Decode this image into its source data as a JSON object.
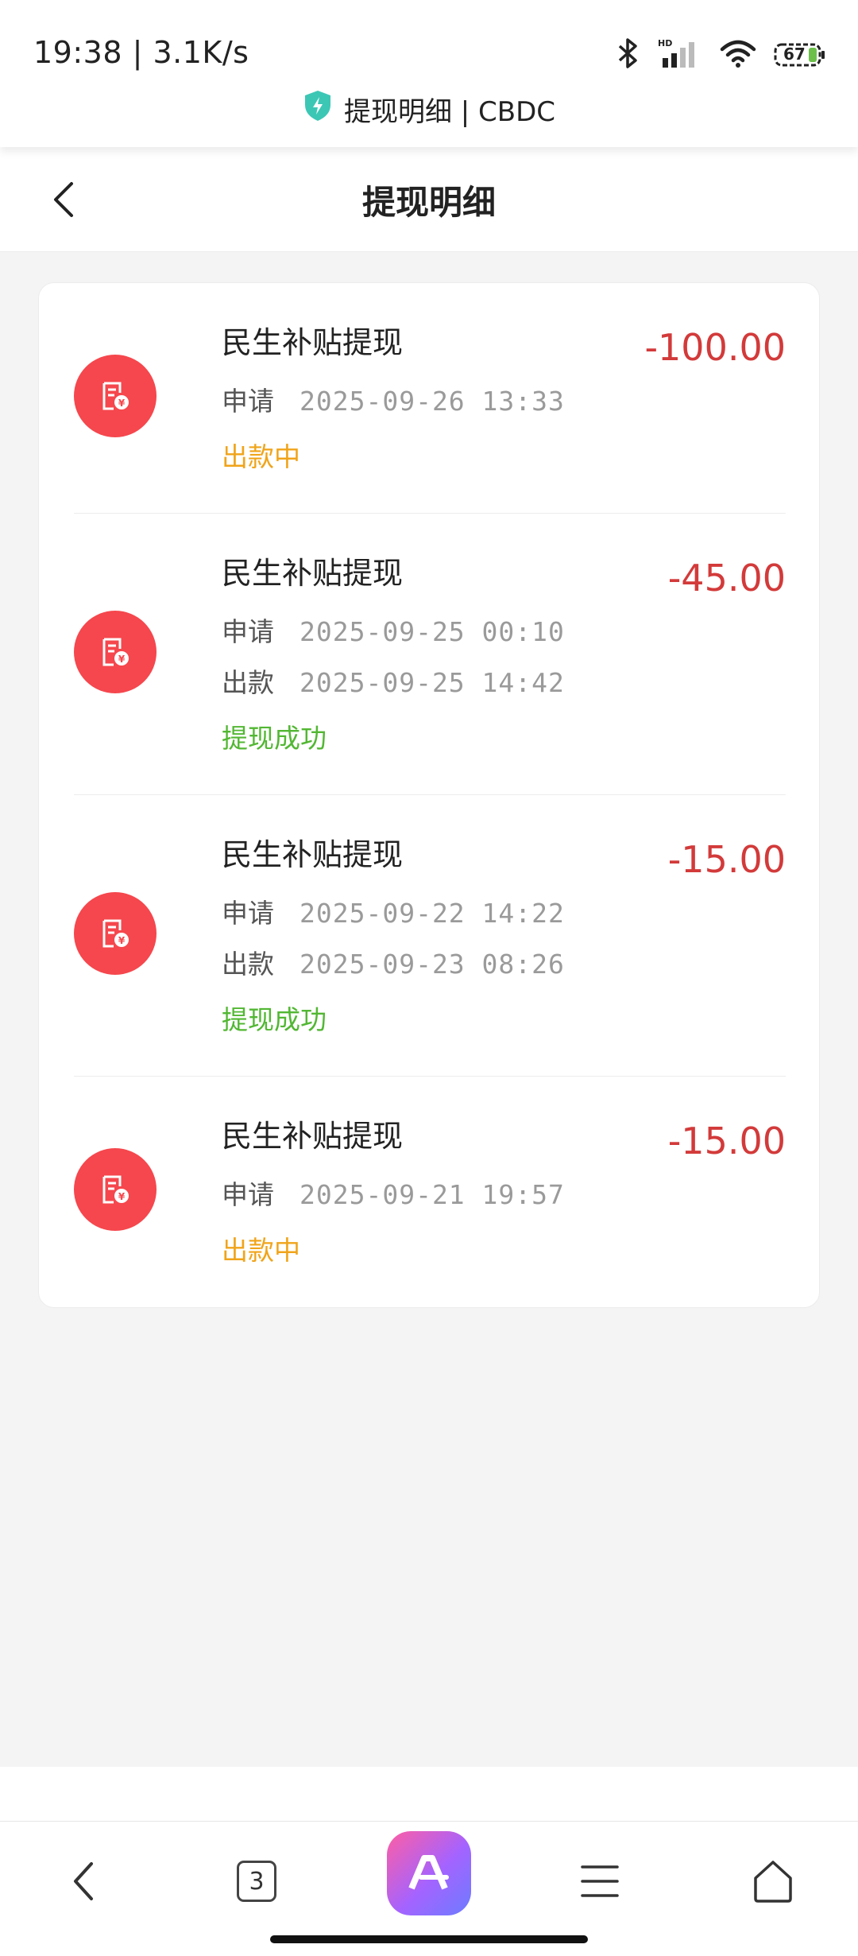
{
  "status_bar": {
    "time_speed": "19:38 | 3.1K/s",
    "site_title": "提现明细 | CBDC",
    "battery": "67"
  },
  "header": {
    "title": "提现明细"
  },
  "records": [
    {
      "title": "民生补贴提现",
      "amount": "-100.00",
      "lines": [
        {
          "label": "申请",
          "value": "2025-09-26  13:33"
        }
      ],
      "status": "出款中",
      "status_type": "pending"
    },
    {
      "title": "民生补贴提现",
      "amount": "-45.00",
      "lines": [
        {
          "label": "申请",
          "value": "2025-09-25  00:10"
        },
        {
          "label": "出款",
          "value": "2025-09-25  14:42"
        }
      ],
      "status": "提现成功",
      "status_type": "success"
    },
    {
      "title": "民生补贴提现",
      "amount": "-15.00",
      "lines": [
        {
          "label": "申请",
          "value": "2025-09-22  14:22"
        },
        {
          "label": "出款",
          "value": "2025-09-23  08:26"
        }
      ],
      "status": "提现成功",
      "status_type": "success"
    },
    {
      "title": "民生补贴提现",
      "amount": "-15.00",
      "lines": [
        {
          "label": "申请",
          "value": "2025-09-21  19:57"
        }
      ],
      "status": "出款中",
      "status_type": "pending"
    }
  ],
  "bottom_nav": {
    "tab_count": "3",
    "items": [
      "back-icon",
      "tabs-icon",
      "ai-assistant-icon",
      "menu-icon",
      "home-icon"
    ]
  },
  "colors": {
    "amount": "#d33a3a",
    "pending": "#f0a41a",
    "success": "#52b733",
    "record_icon_bg": "#f5474d"
  }
}
